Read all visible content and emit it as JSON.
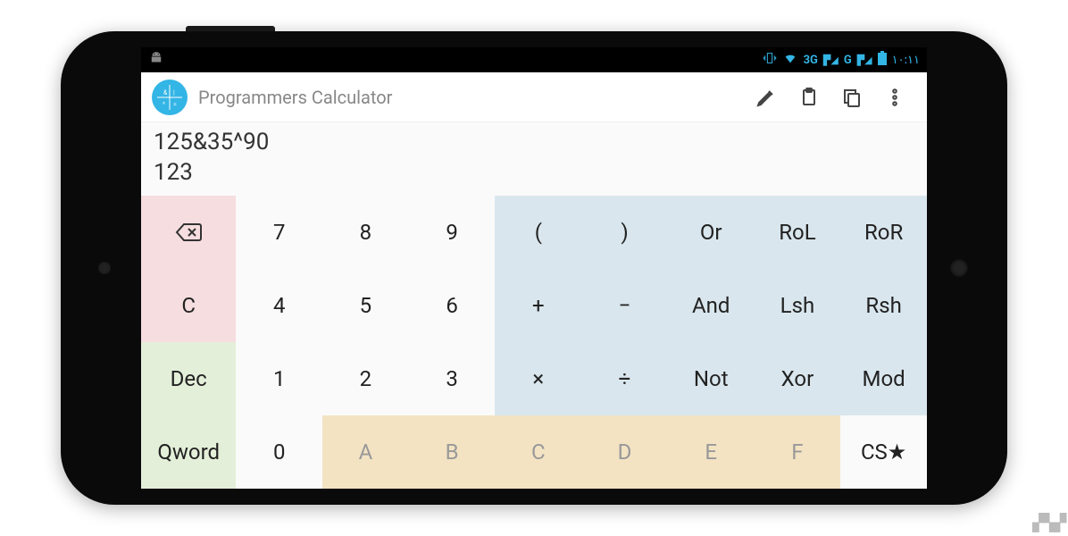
{
  "statusbar": {
    "network1": "3G",
    "network2": "G",
    "time": "١٠:١١"
  },
  "actionbar": {
    "title": "Programmers Calculator"
  },
  "display": {
    "expression": "125&35^90",
    "result": "123"
  },
  "keys": {
    "r0": {
      "c0": "",
      "c1": "7",
      "c2": "8",
      "c3": "9",
      "c4": "(",
      "c5": ")",
      "c6": "Or",
      "c7": "RoL",
      "c8": "RoR"
    },
    "r1": {
      "c0": "C",
      "c1": "4",
      "c2": "5",
      "c3": "6",
      "c4": "+",
      "c5": "−",
      "c6": "And",
      "c7": "Lsh",
      "c8": "Rsh"
    },
    "r2": {
      "c0": "Dec",
      "c1": "1",
      "c2": "2",
      "c3": "3",
      "c4": "×",
      "c5": "÷",
      "c6": "Not",
      "c7": "Xor",
      "c8": "Mod"
    },
    "r3": {
      "c0": "Qword",
      "c1": "0",
      "c2": "A",
      "c3": "B",
      "c4": "C",
      "c5": "D",
      "c6": "E",
      "c7": "F",
      "c8": "CS★"
    }
  }
}
